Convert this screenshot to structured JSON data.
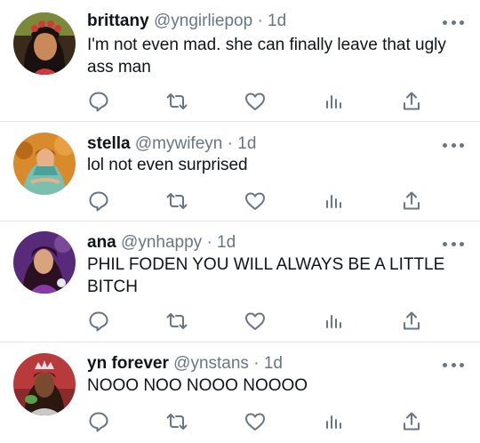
{
  "tweets": [
    {
      "name": "brittany",
      "handle": "@yngirliepop",
      "separator": "·",
      "time": "1d",
      "text": "I'm not even mad. she can finally leave that ugly ass man",
      "avatar": {
        "bg": "#4a1c1c",
        "skin": "#c98a5a",
        "hair": "#1a1010",
        "accent": "#d23a3a"
      }
    },
    {
      "name": "stella",
      "handle": "@mywifeyn",
      "separator": "·",
      "time": "1d",
      "text": "lol not even surprised",
      "avatar": {
        "bg": "#d98a2a",
        "skin": "#e6b088",
        "hair": "#6a3a18",
        "accent": "#4aa39a"
      }
    },
    {
      "name": "ana",
      "handle": "@ynhappy",
      "separator": "·",
      "time": "1d",
      "text": "PHIL FODEN YOU WILL ALWAYS BE A LITTLE BITCH",
      "avatar": {
        "bg": "#5a2a7a",
        "skin": "#d8a47e",
        "hair": "#2a1020",
        "accent": "#8a3aa8"
      }
    },
    {
      "name": "yn forever",
      "handle": "@ynstans",
      "separator": "·",
      "time": "1d",
      "text": "NOOO NOO NOOO NOOOO",
      "avatar": {
        "bg": "#b83a3a",
        "skin": "#7a4a2e",
        "hair": "#2a1810",
        "accent": "#c9c9c9"
      }
    }
  ],
  "icons": {
    "reply": "reply-icon",
    "retweet": "retweet-icon",
    "like": "like-icon",
    "views": "views-icon",
    "share": "share-icon",
    "more": "more-icon"
  },
  "colors": {
    "text": "#0f1419",
    "secondary": "#687684",
    "divider": "#e1e5e8"
  }
}
